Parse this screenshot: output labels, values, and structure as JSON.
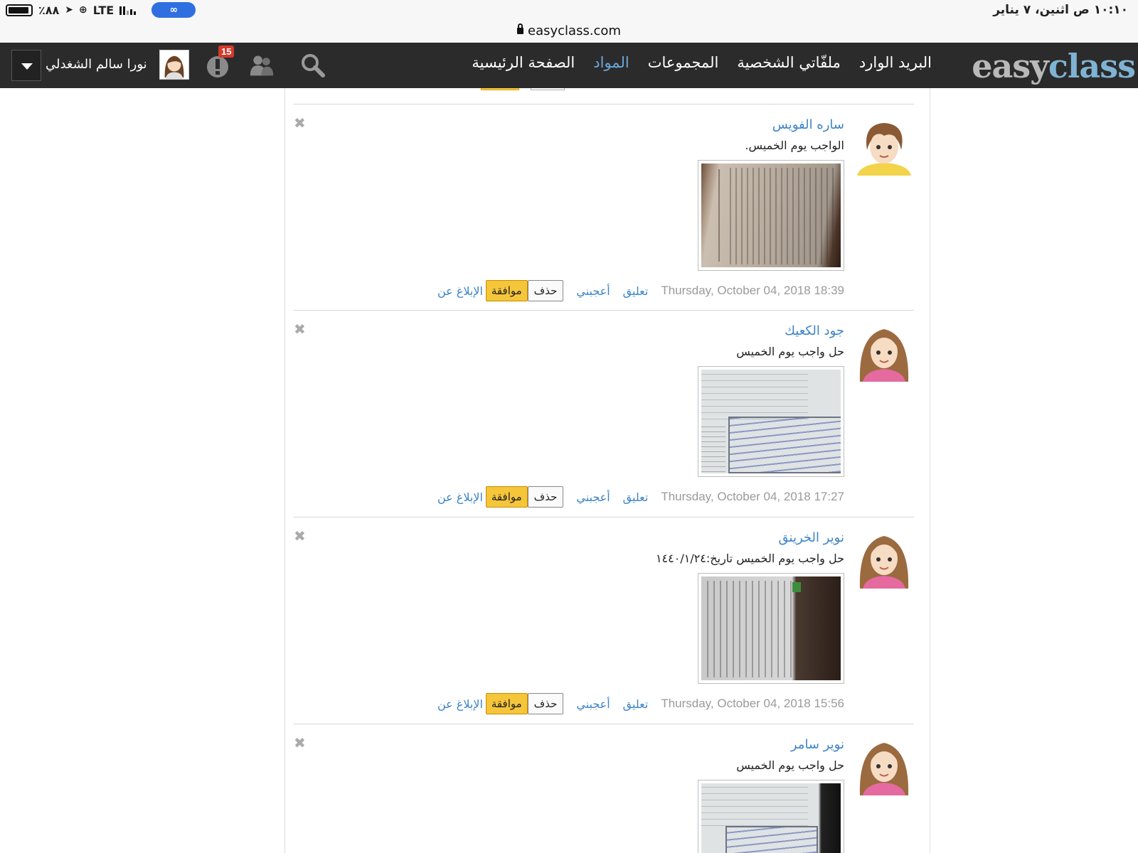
{
  "status_bar": {
    "time": "١٠:١٠ ص اثنين، ٧ يناير",
    "battery": "٪٨٨",
    "network": "LTE"
  },
  "url": "easyclass.com",
  "nav": {
    "brand_part1": "easy",
    "brand_part2": "class",
    "links": [
      "الصفحة الرئيسية",
      "المواد",
      "المجموعات",
      "ملفّاتي الشخصية",
      "البريد الوارد"
    ],
    "active_link": "المواد",
    "notifications_count": "15",
    "username": "نورا سالم الشغدلي",
    "icons": [
      "search-icon",
      "people-icon",
      "notifications-icon",
      "chevron-down-icon"
    ]
  },
  "posts": [
    {
      "author": "ساره الفويس",
      "message": "الواجب يوم الخميس.",
      "timestamp": "Thursday, October 04, 2018 18:39",
      "comment_label": "تعليق",
      "like_label": "أعجبني",
      "delete_label": "حذف",
      "approve_label": "موافقة",
      "report_label": "الإبلاغ عن",
      "avatar": "avatar-girl-short-hair"
    },
    {
      "author": "جود الكعيك",
      "message": "حل واجب يوم الخميس",
      "timestamp": "Thursday, October 04, 2018 17:27",
      "comment_label": "تعليق",
      "like_label": "أعجبني",
      "delete_label": "حذف",
      "approve_label": "موافقة",
      "report_label": "الإبلاغ عن",
      "avatar": "avatar-girl-long-hair"
    },
    {
      "author": "نوير الخرينق",
      "message": "حل واجب يوم الخميس تاريخ:١٤٤٠/١/٢٤",
      "timestamp": "Thursday, October 04, 2018 15:56",
      "comment_label": "تعليق",
      "like_label": "أعجبني",
      "delete_label": "حذف",
      "approve_label": "موافقة",
      "report_label": "الإبلاغ عن",
      "avatar": "avatar-girl-long-hair"
    },
    {
      "author": "نوير سامر",
      "message": "حل واجب يوم الخميس",
      "avatar": "avatar-girl-long-hair"
    }
  ],
  "colors": {
    "nav_bg": "#2b2b2b",
    "link": "#3d84c6",
    "approve": "#f5c53a",
    "badge": "#d6392b"
  }
}
